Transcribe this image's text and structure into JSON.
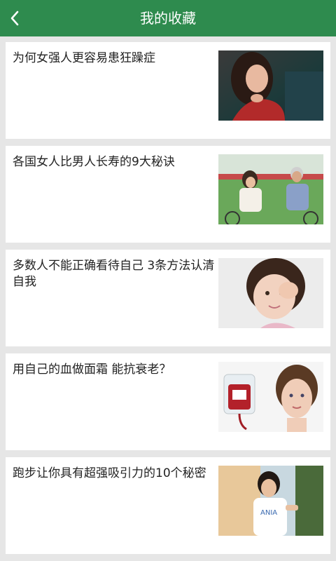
{
  "header": {
    "title": "我的收藏",
    "back_icon": "chevron-left-icon",
    "color": "#2e8b4e"
  },
  "favorites": [
    {
      "title": "为何女强人更容易患狂躁症",
      "thumbnail": "woman-portrait"
    },
    {
      "title": "各国女人比男人长寿的9大秘诀",
      "thumbnail": "couple-cycling"
    },
    {
      "title": "多数人不能正确看待自己 3条方法认清自我",
      "thumbnail": "child-face"
    },
    {
      "title": "用自己的血做面霜 能抗衰老？",
      "thumbnail": "blood-bag-and-woman"
    },
    {
      "title": "跑步让你具有超强吸引力的10个秘密",
      "thumbnail": "young-man-running"
    }
  ]
}
